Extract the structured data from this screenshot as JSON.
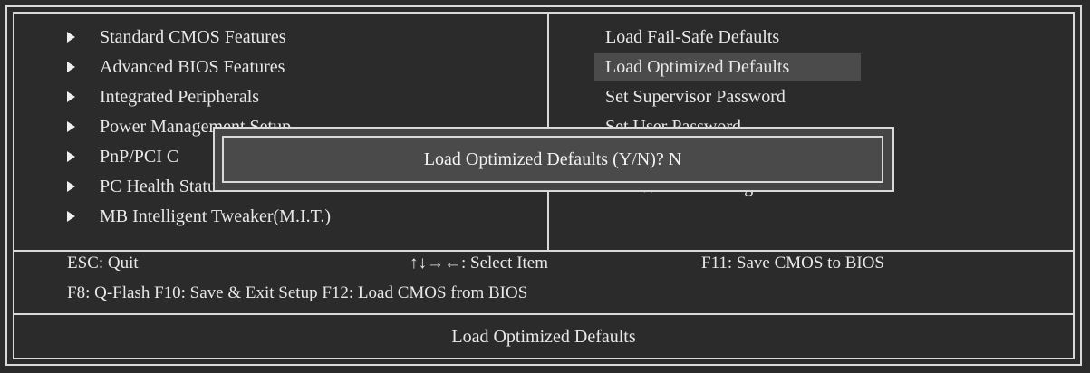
{
  "left_menu": [
    {
      "label": "Standard CMOS Features"
    },
    {
      "label": "Advanced BIOS Features"
    },
    {
      "label": "Integrated Peripherals"
    },
    {
      "label": "Power Management Setup"
    },
    {
      "label": "PnP/PCI C"
    },
    {
      "label": "PC Health Status"
    },
    {
      "label": "MB Intelligent Tweaker(M.I.T.)"
    }
  ],
  "right_menu": [
    {
      "label": "Load Fail-Safe Defaults"
    },
    {
      "label": "Load Optimized Defaults",
      "selected": true
    },
    {
      "label": "Set Supervisor Password"
    },
    {
      "label": "Set User Password"
    },
    {
      "label": "Exit Without Saving"
    }
  ],
  "dialog": {
    "prompt": "Load Optimized Defaults (Y/N)? N"
  },
  "help": {
    "esc": "ESC: Quit",
    "select": "↑↓→←: Select Item",
    "f11": "F11: Save CMOS to BIOS",
    "line2": "F8: Q-Flash F10: Save & Exit Setup F12: Load CMOS from BIOS"
  },
  "status_text": "Load Optimized Defaults",
  "colors": {
    "background": "#2b2b2b",
    "text": "#e8e8e8",
    "selected_bg": "#4b4b4b"
  }
}
